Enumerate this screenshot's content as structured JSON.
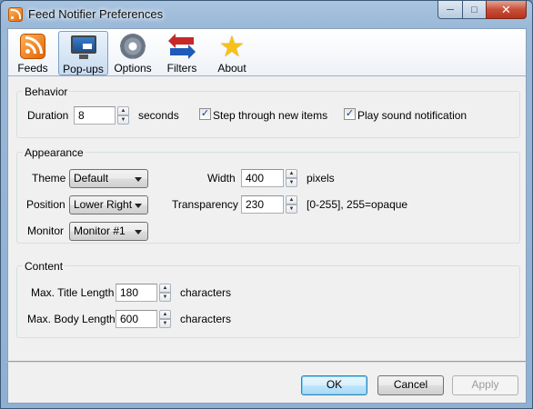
{
  "window": {
    "title": "Feed Notifier Preferences"
  },
  "caption_buttons": {
    "minimize": "─",
    "maximize": "□",
    "close": "✕"
  },
  "toolbar": [
    {
      "id": "feeds",
      "label": "Feeds",
      "icon": "rss-icon"
    },
    {
      "id": "popups",
      "label": "Pop-ups",
      "icon": "monitor-icon",
      "selected": true
    },
    {
      "id": "options",
      "label": "Options",
      "icon": "gear-icon"
    },
    {
      "id": "filters",
      "label": "Filters",
      "icon": "filter-arrows-icon"
    },
    {
      "id": "about",
      "label": "About",
      "icon": "star-icon"
    }
  ],
  "behavior": {
    "title": "Behavior",
    "duration_label": "Duration",
    "duration_value": "8",
    "duration_unit": "seconds",
    "step_label": "Step through new items",
    "step_checked": true,
    "sound_label": "Play sound notification",
    "sound_checked": true
  },
  "appearance": {
    "title": "Appearance",
    "theme_label": "Theme",
    "theme_value": "Default",
    "position_label": "Position",
    "position_value": "Lower Right",
    "monitor_label": "Monitor",
    "monitor_value": "Monitor #1",
    "width_label": "Width",
    "width_value": "400",
    "width_unit": "pixels",
    "transparency_label": "Transparency",
    "transparency_value": "230",
    "transparency_hint": "[0-255], 255=opaque"
  },
  "content": {
    "title": "Content",
    "title_len_label": "Max. Title Length",
    "title_len_value": "180",
    "title_len_unit": "characters",
    "body_len_label": "Max. Body Length",
    "body_len_value": "600",
    "body_len_unit": "characters"
  },
  "buttons": {
    "ok": "OK",
    "cancel": "Cancel",
    "apply": "Apply",
    "apply_disabled": true
  },
  "check_glyph": "✓",
  "spin_glyphs": {
    "up": "▲",
    "down": "▼"
  }
}
